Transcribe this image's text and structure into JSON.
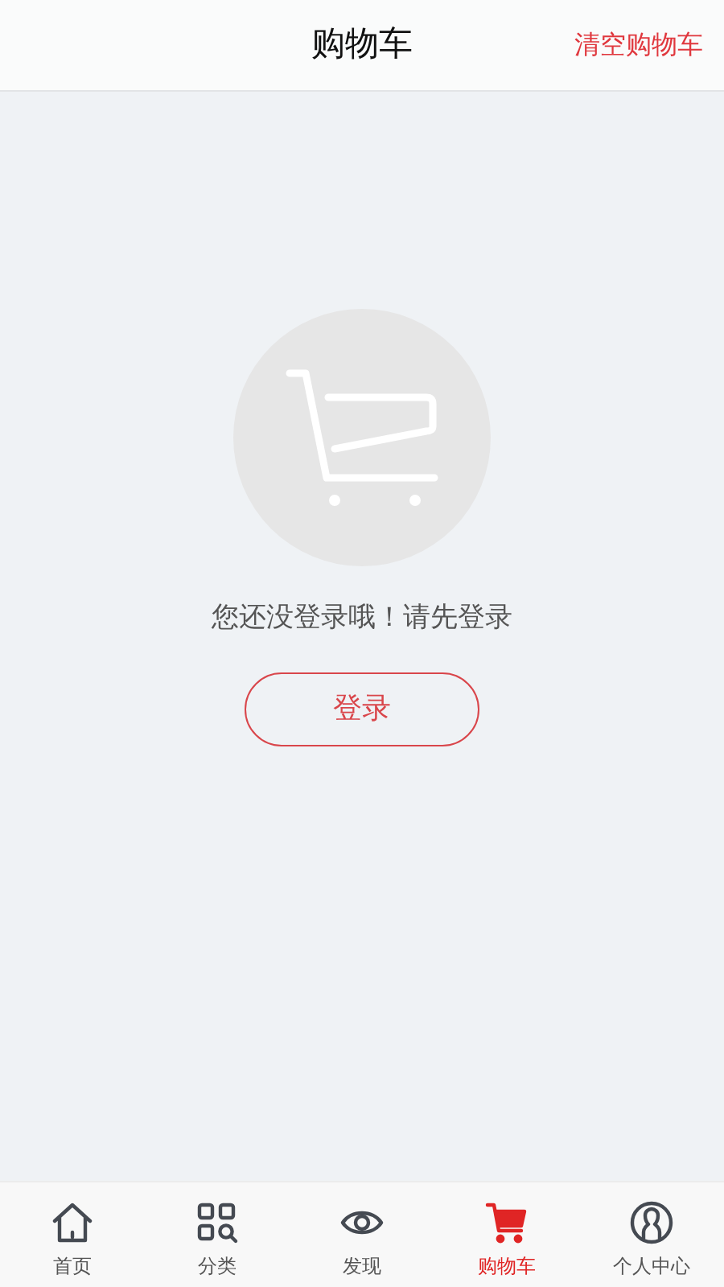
{
  "header": {
    "title": "购物车",
    "action": "清空购物车"
  },
  "empty_state": {
    "message": "您还没登录哦！请先登录",
    "button": "登录"
  },
  "tab_bar": [
    {
      "kind": "home",
      "label": "首页",
      "selected": false
    },
    {
      "kind": "category",
      "label": "分类",
      "selected": false
    },
    {
      "kind": "discover",
      "label": "发现",
      "selected": false
    },
    {
      "kind": "cart",
      "label": "购物车",
      "selected": true
    },
    {
      "kind": "profile",
      "label": "个人中心",
      "selected": false
    }
  ]
}
